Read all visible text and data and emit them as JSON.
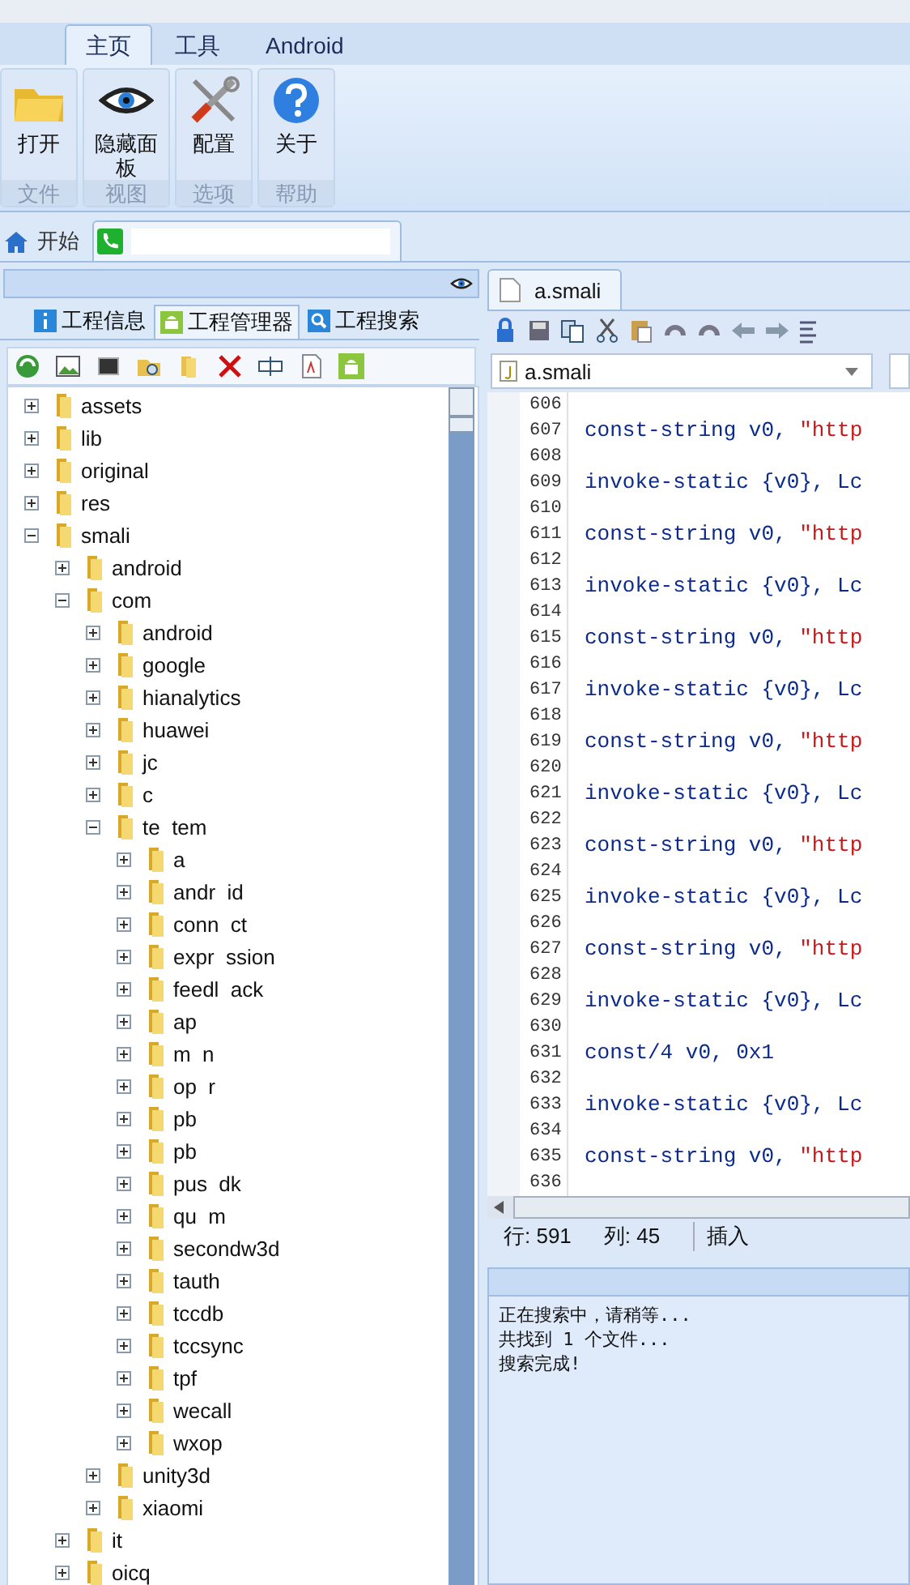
{
  "ribbon_tabs": [
    {
      "label": "主页",
      "selected": true
    },
    {
      "label": "工具",
      "selected": false
    },
    {
      "label": "Android",
      "selected": false
    }
  ],
  "ribbon_groups": [
    {
      "button": "打开",
      "group": "文件"
    },
    {
      "button": "隐藏面板",
      "group": "视图"
    },
    {
      "button": "配置",
      "group": "选项"
    },
    {
      "button": "关于",
      "group": "帮助"
    }
  ],
  "document_tabs": [
    {
      "label": "开始",
      "selected": false
    },
    {
      "selected": true
    }
  ],
  "panel_tabs": [
    {
      "label": "工程信息",
      "selected": false
    },
    {
      "label": "工程管理器",
      "selected": true
    },
    {
      "label": "工程搜索",
      "selected": false
    }
  ],
  "tree": [
    {
      "label": "assets",
      "expanded": false
    },
    {
      "label": "lib",
      "expanded": false
    },
    {
      "label": "original",
      "expanded": false
    },
    {
      "label": "res",
      "expanded": false
    },
    {
      "label": "smali",
      "expanded": true,
      "children": [
        {
          "label": "android",
          "expanded": false
        },
        {
          "label": "com",
          "expanded": true,
          "children": [
            {
              "label": "android",
              "expanded": false
            },
            {
              "label": "google",
              "expanded": false
            },
            {
              "label": "hianalytics",
              "expanded": false
            },
            {
              "label": "huawei",
              "expanded": false
            },
            {
              "label": "jc",
              "expanded": false
            },
            {
              "label": "c",
              "expanded": false
            },
            {
              "label": "te  tem",
              "expanded": true,
              "children": [
                {
                  "label": "a",
                  "expanded": false
                },
                {
                  "label": "andr  id",
                  "expanded": false
                },
                {
                  "label": "conn  ct",
                  "expanded": false
                },
                {
                  "label": "expr  ssion",
                  "expanded": false
                },
                {
                  "label": "feedl  ack",
                  "expanded": false
                },
                {
                  "label": "ap",
                  "expanded": false
                },
                {
                  "label": "m  n",
                  "expanded": false
                },
                {
                  "label": "op  r",
                  "expanded": false
                },
                {
                  "label": "pb",
                  "expanded": false
                },
                {
                  "label": "pb",
                  "expanded": false
                },
                {
                  "label": "pus  dk",
                  "expanded": false
                },
                {
                  "label": "qu  m",
                  "expanded": false
                },
                {
                  "label": "secondw3d",
                  "expanded": false
                },
                {
                  "label": "tauth",
                  "expanded": false
                },
                {
                  "label": "tccdb",
                  "expanded": false
                },
                {
                  "label": "tccsync",
                  "expanded": false
                },
                {
                  "label": "tpf",
                  "expanded": false
                },
                {
                  "label": "wecall",
                  "expanded": false
                },
                {
                  "label": "wxop",
                  "expanded": false
                }
              ]
            },
            {
              "label": "unity3d",
              "expanded": false
            },
            {
              "label": "xiaomi",
              "expanded": false
            }
          ]
        },
        {
          "label": "it",
          "expanded": false
        },
        {
          "label": "oicq",
          "expanded": false
        }
      ]
    }
  ],
  "editor": {
    "tab": "a.smali",
    "file": "a.smali",
    "lines": [
      {
        "number": "606"
      },
      {
        "number": "607",
        "kind": "string",
        "text": "const-string v0, ",
        "literal": "\"http"
      },
      {
        "number": "608"
      },
      {
        "number": "609",
        "kind": "code",
        "text": "invoke-static {v0}, Lc"
      },
      {
        "number": "610"
      },
      {
        "number": "611",
        "kind": "string",
        "text": "const-string v0, ",
        "literal": "\"http"
      },
      {
        "number": "612"
      },
      {
        "number": "613",
        "kind": "code",
        "text": "invoke-static {v0}, Lc"
      },
      {
        "number": "614"
      },
      {
        "number": "615",
        "kind": "string",
        "text": "const-string v0, ",
        "literal": "\"http"
      },
      {
        "number": "616"
      },
      {
        "number": "617",
        "kind": "code",
        "text": "invoke-static {v0}, Lc"
      },
      {
        "number": "618"
      },
      {
        "number": "619",
        "kind": "string",
        "text": "const-string v0, ",
        "literal": "\"http"
      },
      {
        "number": "620"
      },
      {
        "number": "621",
        "kind": "code",
        "text": "invoke-static {v0}, Lc"
      },
      {
        "number": "622"
      },
      {
        "number": "623",
        "kind": "string",
        "text": "const-string v0, ",
        "literal": "\"http"
      },
      {
        "number": "624"
      },
      {
        "number": "625",
        "kind": "code",
        "text": "invoke-static {v0}, Lc"
      },
      {
        "number": "626"
      },
      {
        "number": "627",
        "kind": "string",
        "text": "const-string v0, ",
        "literal": "\"http"
      },
      {
        "number": "628"
      },
      {
        "number": "629",
        "kind": "code",
        "text": "invoke-static {v0}, Lc"
      },
      {
        "number": "630"
      },
      {
        "number": "631",
        "kind": "code",
        "text": "const/4 v0, 0x1"
      },
      {
        "number": "632"
      },
      {
        "number": "633",
        "kind": "code",
        "text": "invoke-static {v0}, Lc"
      },
      {
        "number": "634"
      },
      {
        "number": "635",
        "kind": "string",
        "text": "const-string v0, ",
        "literal": "\"http"
      },
      {
        "number": "636"
      }
    ],
    "status": {
      "line": "行: 591",
      "column": "列: 45",
      "mode": "插入"
    }
  },
  "output": [
    "正在搜索中，请稍等...",
    "共找到 1 个文件...",
    "搜索完成!"
  ]
}
